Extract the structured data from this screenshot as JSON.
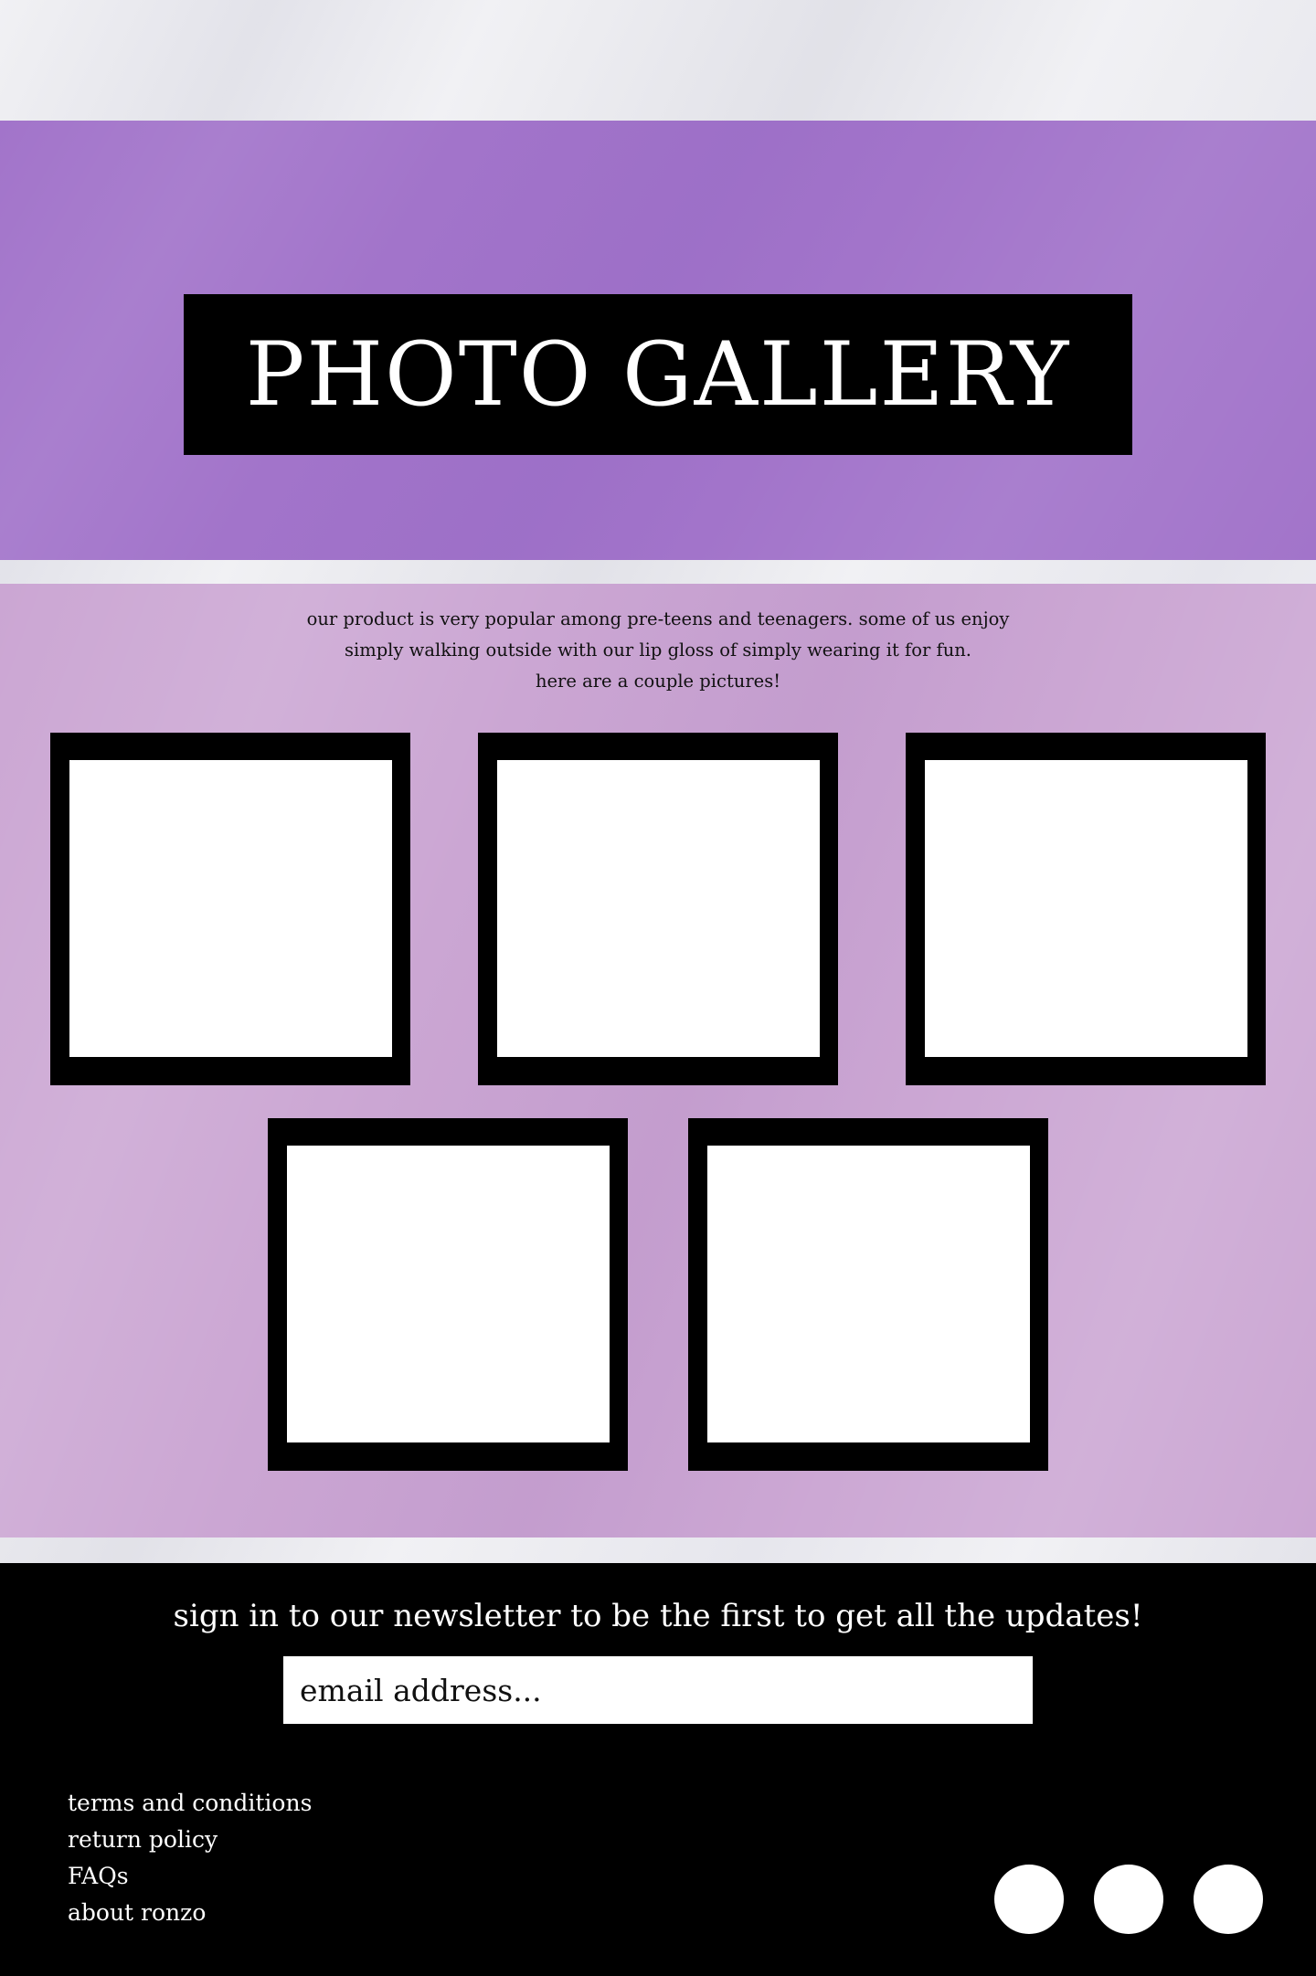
{
  "hero": {
    "title": "PHOTO GALLERY",
    "background_color": "#a274ca"
  },
  "gallery": {
    "background_color": "#cba6d3",
    "intro_lines": [
      "our product is very popular among pre-teens and teenagers. some of us enjoy",
      "simply walking outside with our lip gloss of simply wearing it for fun.",
      "here are a couple pictures!"
    ],
    "photo_count": 5
  },
  "footer": {
    "newsletter_heading": "sign in to our newsletter to be the first to get all the updates!",
    "email_placeholder": "email address...",
    "links": [
      "terms and conditions",
      "return policy",
      "FAQs",
      "about ronzo"
    ],
    "social_icons": [
      "social-circle-icon",
      "social-circle-icon",
      "social-circle-icon"
    ]
  }
}
